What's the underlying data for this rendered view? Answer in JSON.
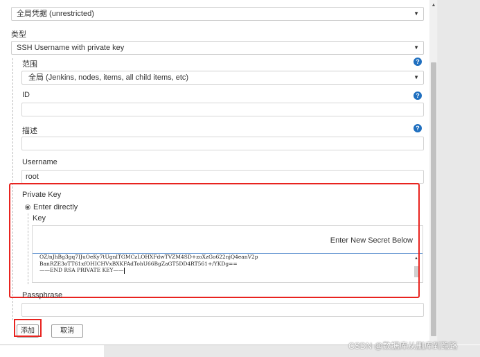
{
  "credentials_domain": {
    "value": "全局凭据 (unrestricted)"
  },
  "kind": {
    "label": "类型",
    "value": "SSH Username with private key"
  },
  "scope": {
    "label": "范围",
    "value": "全局 (Jenkins, nodes, items, all child items, etc)"
  },
  "id_field": {
    "label": "ID",
    "value": ""
  },
  "description": {
    "label": "描述",
    "value": ""
  },
  "username": {
    "label": "Username",
    "value": "root"
  },
  "private_key": {
    "label": "Private Key",
    "option": "Enter directly",
    "key_label": "Key",
    "secret_note": "Enter New Secret Below",
    "key_lines": [
      "OZ/nJhBg3gq7IJuOeKy7tUgnlTGMCzLOHXFdwTVZM4SD+zoXzGo622njQ4eanV2p",
      "BanRZE3oTT61xfOHICHVxBXKFAdTohU66BgZaGT5DD4RT561+/YKDg==",
      "——END RSA PRIVATE KEY——"
    ]
  },
  "passphrase": {
    "label": "Passphrase",
    "value": ""
  },
  "buttons": {
    "add": "添加",
    "cancel": "取消"
  },
  "help_icon": "?",
  "watermark": "CSDN @数据库从删库到跑路",
  "colors": {
    "highlight": "#e8231f",
    "help": "#1f6fbf"
  }
}
